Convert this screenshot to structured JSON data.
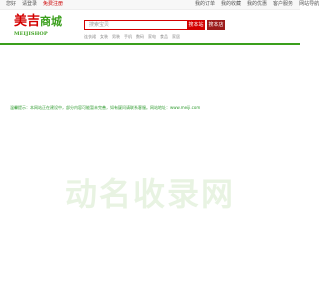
{
  "topbar": {
    "left_items": [
      "您好",
      "请登录",
      "免费注册"
    ],
    "right_items": [
      "我的订单",
      "我的收藏",
      "我的优惠",
      "客户服务",
      "网站导航"
    ]
  },
  "logo": {
    "text_red": "美吉",
    "text_green": "商城",
    "subtitle": "MEIJISHOP"
  },
  "search": {
    "placeholder": "搜索宝贝",
    "button_site": "搜本站",
    "button_store": "搜本店"
  },
  "hotwords": [
    "连衣裙",
    "女装",
    "男装",
    "手机",
    "数码",
    "家电",
    "食品",
    "家居"
  ],
  "notice": "温馨提示：本网站正在建设中，部分内容可能暂未完善，如有疑问请联系客服。网站地址：www.meiji.com",
  "brand_watermark": "动名收录网",
  "colors": {
    "accent_red": "#d40000",
    "accent_green": "#3a9f1c",
    "watermark": "#e8f3e2"
  }
}
